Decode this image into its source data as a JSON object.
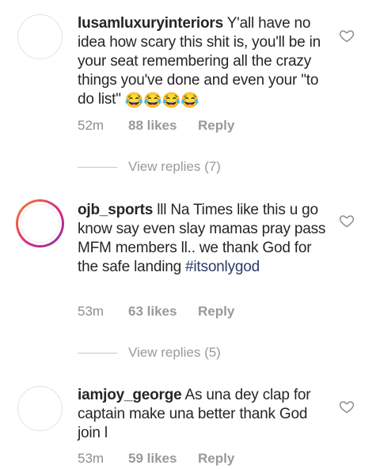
{
  "comments": [
    {
      "username": "lusamluxuryinteriors",
      "text": " Y'all have no idea how scary this shit is, you'll be in your seat remembering all the crazy things you've done and even your \"to do list\" ",
      "emoji": "😂😂😂😂",
      "time": "52m",
      "likes": "88 likes",
      "reply": "Reply",
      "view_replies": "View replies (7)",
      "has_story": false
    },
    {
      "username": "ojb_sports",
      "text": " lll Na Times like this u go know say even slay mamas pray pass MFM members ll.. we thank God for the safe landing ",
      "hashtag": "#itsonlygod",
      "time": "53m",
      "likes": "63 likes",
      "reply": "Reply",
      "view_replies": "View replies (5)",
      "has_story": true
    },
    {
      "username": "iamjoy_george",
      "text": " As una dey clap for captain make una better thank God join l",
      "time": "53m",
      "likes": "59 likes",
      "reply": "Reply",
      "has_story": false
    }
  ],
  "icons": {
    "like": "heart-outline-icon"
  },
  "colors": {
    "text": "#262626",
    "muted": "#8e8e8e",
    "hashtag": "#2b3a67",
    "story_ring_start": "#f58529",
    "story_ring_end": "#8134af"
  }
}
